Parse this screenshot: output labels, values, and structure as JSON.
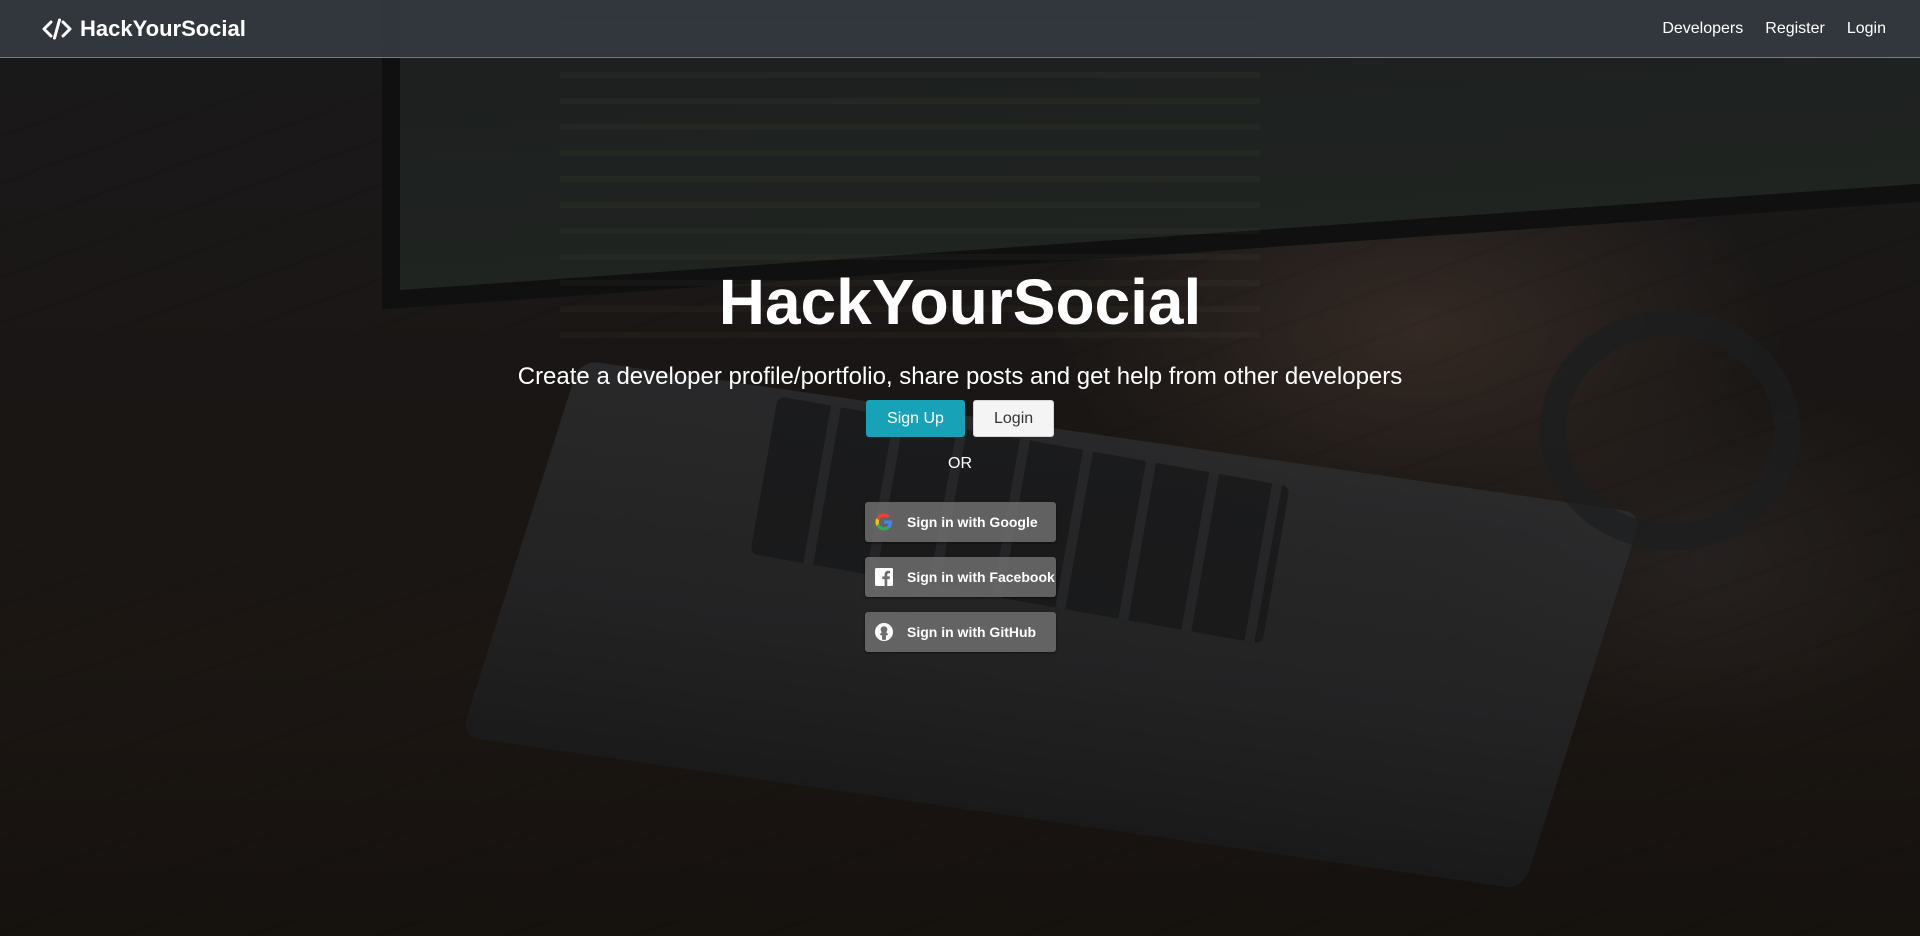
{
  "navbar": {
    "brand": "HackYourSocial",
    "links": [
      "Developers",
      "Register",
      "Login"
    ]
  },
  "hero": {
    "title": "HackYourSocial",
    "lead": "Create a developer profile/portfolio, share posts and get help from other developers",
    "signup_label": "Sign Up",
    "login_label": "Login",
    "or_text": "OR"
  },
  "oauth": {
    "google": "Sign in with Google",
    "facebook": "Sign in with Facebook",
    "github": "Sign in with GitHub"
  },
  "colors": {
    "accent": "#17a2b8",
    "navbar": "#343a40"
  }
}
